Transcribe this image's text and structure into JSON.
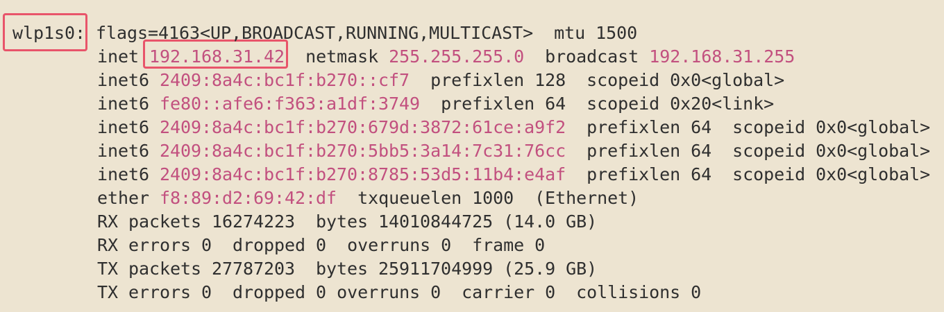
{
  "interface": {
    "name": "wlp1s0:",
    "flags": "flags=4163<UP,BROADCAST,RUNNING,MULTICAST>",
    "mtu": "mtu 1500"
  },
  "inet": {
    "label": "inet",
    "address": "192.168.31.42",
    "netmask_label": "netmask",
    "netmask": "255.255.255.0",
    "broadcast_label": "broadcast",
    "broadcast": "192.168.31.255"
  },
  "inet6": [
    {
      "label": "inet6",
      "address": "2409:8a4c:bc1f:b270::cf7",
      "prefixlen": "prefixlen 128",
      "scopeid": "scopeid 0x0<global>"
    },
    {
      "label": "inet6",
      "address": "fe80::afe6:f363:a1df:3749",
      "prefixlen": "prefixlen 64",
      "scopeid": "scopeid 0x20<link>"
    },
    {
      "label": "inet6",
      "address": "2409:8a4c:bc1f:b270:679d:3872:61ce:a9f2",
      "prefixlen": "prefixlen 64",
      "scopeid": "scopeid 0x0<global>"
    },
    {
      "label": "inet6",
      "address": "2409:8a4c:bc1f:b270:5bb5:3a14:7c31:76cc",
      "prefixlen": "prefixlen 64",
      "scopeid": "scopeid 0x0<global>"
    },
    {
      "label": "inet6",
      "address": "2409:8a4c:bc1f:b270:8785:53d5:11b4:e4af",
      "prefixlen": "prefixlen 64",
      "scopeid": "scopeid 0x0<global>"
    }
  ],
  "ether": {
    "label": "ether",
    "address": "f8:89:d2:69:42:df",
    "txqueuelen": "txqueuelen 1000",
    "type": "(Ethernet)"
  },
  "rx_packets": {
    "packets": "RX packets 16274223",
    "bytes": "bytes 14010844725 (14.0 GB)"
  },
  "rx_errors": {
    "errors": "RX errors 0",
    "dropped": "dropped 0",
    "overruns": "overruns 0",
    "frame": "frame 0"
  },
  "tx_packets": {
    "packets": "TX packets 27787203",
    "bytes": "bytes 25911704999 (25.9 GB)"
  },
  "tx_errors": {
    "errors": "TX errors 0",
    "dropped": "dropped 0",
    "overruns": "overruns 0",
    "carrier": "carrier 0",
    "collisions": "collisions 0"
  },
  "colors": {
    "background": "#ede4d1",
    "text": "#2f2f2f",
    "address": "#c2507f",
    "highlight": "#e8546a"
  }
}
